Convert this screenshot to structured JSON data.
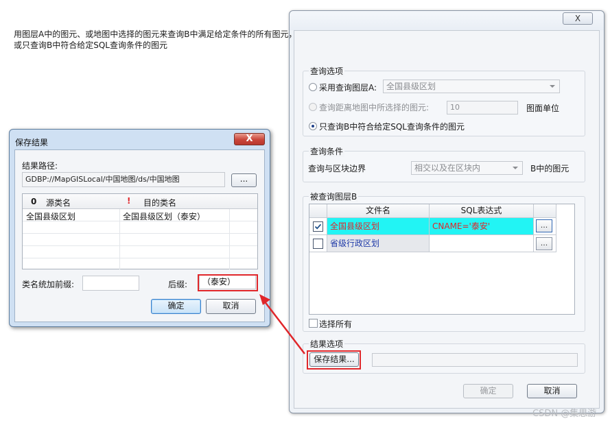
{
  "query_dialog": {
    "close_glyph": "X",
    "description": "用图层A中的图元、或地图中选择的图元来查询B中满足给定条件的所有图元，或只查询B中符合给定SQL查询条件的图元",
    "query_options": {
      "title": "查询选项",
      "option_layer_a": "采用查询图层A:",
      "layer_a_value": "全国县级区划",
      "option_distance": "查询距离地图中所选择的图元:",
      "distance_value": "10",
      "distance_unit": "图面单位",
      "option_sql_only": "只查询B中符合给定SQL查询条件的图元",
      "selected": "option_sql_only"
    },
    "query_conditions": {
      "title": "查询条件",
      "boundary_label": "查询与区块边界",
      "boundary_value": "相交以及在区块内",
      "suffix_label": "B中的图元"
    },
    "layer_b": {
      "title": "被查询图层B",
      "columns": [
        "文件名",
        "SQL表达式"
      ],
      "rows": [
        {
          "checked": true,
          "name": "全国县级区划",
          "sql": "CNAME='泰安'"
        },
        {
          "checked": false,
          "name": "省级行政区划",
          "sql": ""
        }
      ],
      "ellipsis": "...",
      "select_all": "选择所有"
    },
    "result_options": {
      "title": "结果选项",
      "save_button": "保存结果...",
      "save_path": ""
    },
    "ok_button": "确定",
    "cancel_button": "取消"
  },
  "save_dialog": {
    "title": "保存结果",
    "close_glyph": "X",
    "path_label": "结果路径:",
    "path_value": "GDBP://MapGISLocal/中国地图/ds/中国地图",
    "browse_button": "...",
    "columns": {
      "source_icon": "0",
      "source": "源类名",
      "target_icon": "!",
      "target": "目的类名"
    },
    "rows": [
      {
        "source": "全国县级区划",
        "target": "全国县级区划（泰安）"
      }
    ],
    "prefix_label": "类名统加前缀:",
    "prefix_value": "",
    "suffix_label": "后缀:",
    "suffix_value": "（泰安）",
    "ok_button": "确定",
    "cancel_button": "取消"
  },
  "watermark": "CSDN @集思游",
  "colors": {
    "highlight_row": "#22f4f4",
    "annotation": "#e0262a",
    "link_text": "#1f3aa8"
  }
}
